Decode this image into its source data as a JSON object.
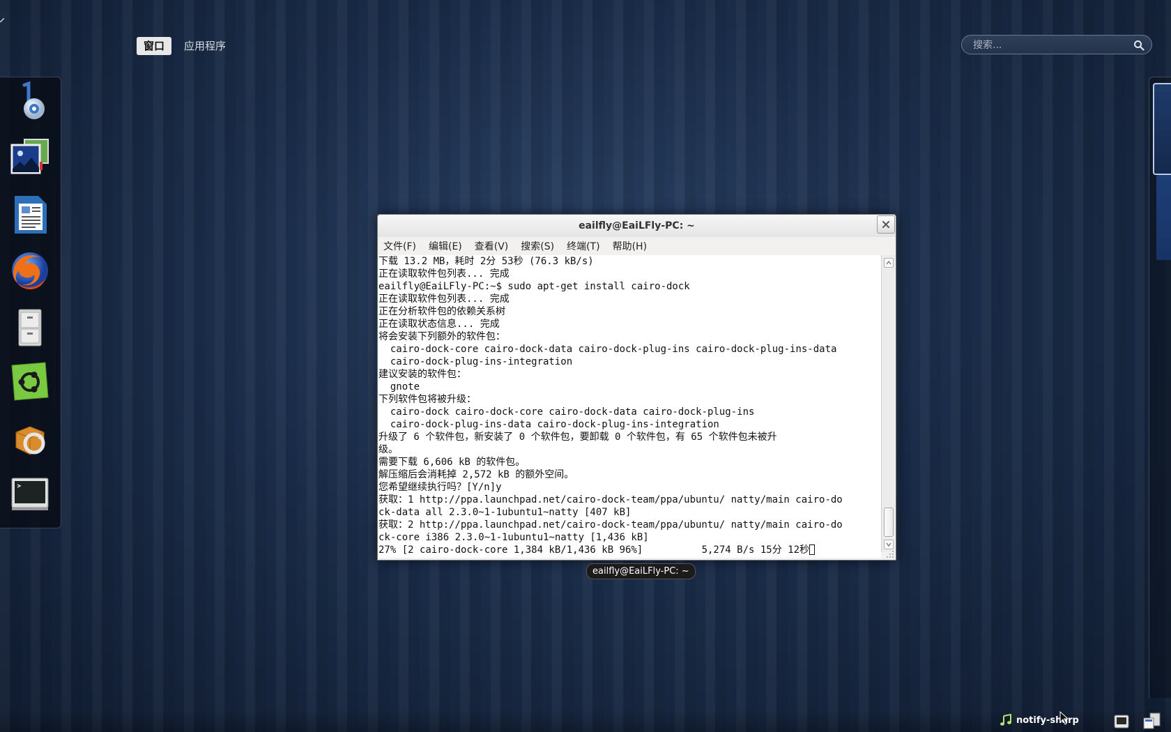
{
  "overview": {
    "tabs": [
      {
        "label": "窗口",
        "active": true
      },
      {
        "label": "应用程序",
        "active": false
      }
    ],
    "search_placeholder": "搜索..."
  },
  "dock": {
    "items": [
      {
        "name": "banshee-icon"
      },
      {
        "name": "image-viewer-icon"
      },
      {
        "name": "libreoffice-writer-icon"
      },
      {
        "name": "firefox-icon"
      },
      {
        "name": "file-cabinet-icon"
      },
      {
        "name": "ubuntu-software-center-icon"
      },
      {
        "name": "update-manager-icon"
      },
      {
        "name": "terminal-icon"
      }
    ]
  },
  "terminal": {
    "title": "eailfly@EaiLFly-PC: ~",
    "menu": [
      "文件(F)",
      "编辑(E)",
      "查看(V)",
      "搜索(S)",
      "终端(T)",
      "帮助(H)"
    ],
    "lines": [
      "下载 13.2 MB，耗时 2分 53秒 (76.3 kB/s)",
      "正在读取软件包列表... 完成",
      "eailfly@EaiLFly-PC:~$ sudo apt-get install cairo-dock",
      "正在读取软件包列表... 完成",
      "正在分析软件包的依赖关系树",
      "正在读取状态信息... 完成",
      "将会安装下列额外的软件包：",
      "  cairo-dock-core cairo-dock-data cairo-dock-plug-ins cairo-dock-plug-ins-data",
      "  cairo-dock-plug-ins-integration",
      "建议安装的软件包：",
      "  gnote",
      "下列软件包将被升级：",
      "  cairo-dock cairo-dock-core cairo-dock-data cairo-dock-plug-ins",
      "  cairo-dock-plug-ins-data cairo-dock-plug-ins-integration",
      "升级了 6 个软件包，新安装了 0 个软件包，要卸载 0 个软件包，有 65 个软件包未被升",
      "级。",
      "需要下载 6,606 kB 的软件包。",
      "解压缩后会消耗掉 2,572 kB 的额外空间。",
      "您希望继续执行吗？[Y/n]y",
      "获取：1 http://ppa.launchpad.net/cairo-dock-team/ppa/ubuntu/ natty/main cairo-do",
      "ck-data all 2.3.0~1-1ubuntu1~natty [407 kB]",
      "获取：2 http://ppa.launchpad.net/cairo-dock-team/ppa/ubuntu/ natty/main cairo-do",
      "ck-core i386 2.3.0~1-1ubuntu1~natty [1,436 kB]",
      "27% [2 cairo-dock-core 1,384 kB/1,436 kB 96%]          5,274 B/s 15分 12秒"
    ]
  },
  "window_label": "eailfly@EaiLFly-PC: ~",
  "panel": {
    "notify_label": "notify-sharp"
  }
}
